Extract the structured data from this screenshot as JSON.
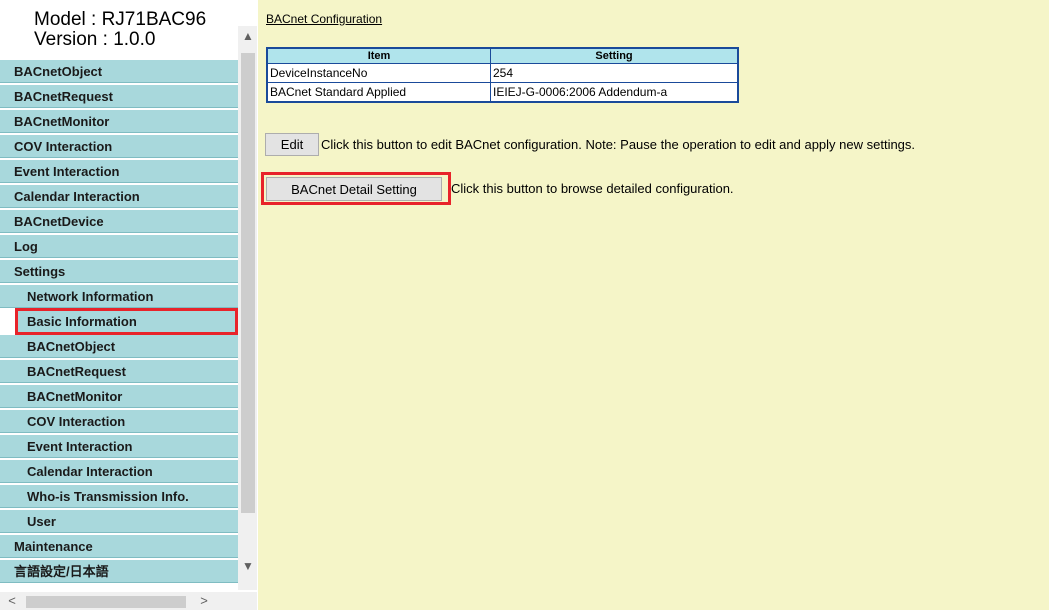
{
  "header": {
    "model": "Model : RJ71BAC96",
    "version": "Version : 1.0.0"
  },
  "sidebar": {
    "items": [
      {
        "label": "BACnetObject",
        "level": 0,
        "selected": false
      },
      {
        "label": "BACnetRequest",
        "level": 0,
        "selected": false
      },
      {
        "label": "BACnetMonitor",
        "level": 0,
        "selected": false
      },
      {
        "label": "COV Interaction",
        "level": 0,
        "selected": false
      },
      {
        "label": "Event Interaction",
        "level": 0,
        "selected": false
      },
      {
        "label": "Calendar Interaction",
        "level": 0,
        "selected": false
      },
      {
        "label": "BACnetDevice",
        "level": 0,
        "selected": false
      },
      {
        "label": "Log",
        "level": 0,
        "selected": false
      },
      {
        "label": "Settings",
        "level": 0,
        "selected": false
      },
      {
        "label": "Network Information",
        "level": 1,
        "selected": false
      },
      {
        "label": "Basic Information",
        "level": 1,
        "selected": true
      },
      {
        "label": "BACnetObject",
        "level": 1,
        "selected": false
      },
      {
        "label": "BACnetRequest",
        "level": 1,
        "selected": false
      },
      {
        "label": "BACnetMonitor",
        "level": 1,
        "selected": false
      },
      {
        "label": "COV Interaction",
        "level": 1,
        "selected": false
      },
      {
        "label": "Event Interaction",
        "level": 1,
        "selected": false
      },
      {
        "label": "Calendar Interaction",
        "level": 1,
        "selected": false
      },
      {
        "label": "Who-is Transmission Info.",
        "level": 1,
        "selected": false
      },
      {
        "label": "User",
        "level": 1,
        "selected": false
      },
      {
        "label": "Maintenance",
        "level": 0,
        "selected": false
      },
      {
        "label": "言語設定/日本語",
        "level": 0,
        "selected": false
      }
    ]
  },
  "scroll_icons": {
    "up": "▲",
    "down": "▼",
    "left": "<",
    "right": ">"
  },
  "main": {
    "section_link": "BACnet Configuration",
    "table": {
      "headers": [
        "Item",
        "Setting"
      ],
      "rows": [
        [
          "DeviceInstanceNo",
          "254"
        ],
        [
          "BACnet Standard Applied",
          "IEIEJ-G-0006:2006 Addendum-a"
        ]
      ]
    },
    "edit_button": "Edit",
    "edit_note": "Click this button to edit BACnet configuration. Note: Pause the operation to edit and apply new settings.",
    "detail_button": "BACnet Detail Setting",
    "detail_note": "Click this button to browse detailed configuration."
  },
  "colors": {
    "menu_bg": "#a8d8dc",
    "main_bg": "#f5f5c8",
    "table_border": "#1a4a9a",
    "table_header_bg": "#b0e4ec",
    "highlight": "#e8232a"
  }
}
